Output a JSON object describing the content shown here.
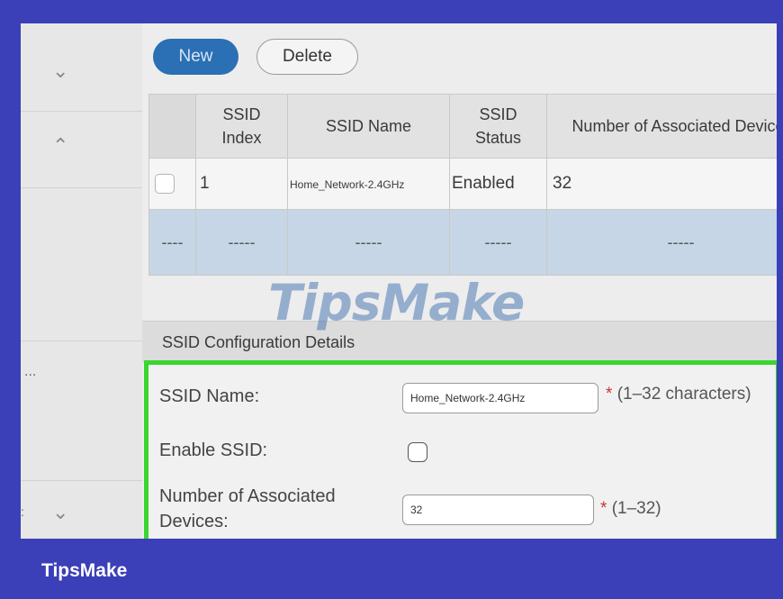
{
  "toolbar": {
    "new_label": "New",
    "delete_label": "Delete"
  },
  "sidebar": {
    "dots": "...",
    "colon": ":"
  },
  "table": {
    "headers": [
      "",
      "SSID Index",
      "SSID Name",
      "SSID Status",
      "Number of Associated Devices"
    ],
    "rows": [
      {
        "index": "1",
        "name": "Home_Network-2.4GHz",
        "status": "Enabled",
        "devices": "32"
      },
      {
        "checkbox": "----",
        "index": "-----",
        "name": "-----",
        "status": "-----",
        "devices": "-----"
      }
    ]
  },
  "watermark": "TipsMake",
  "details": {
    "title": "SSID Configuration Details",
    "ssid_name_label": "SSID Name:",
    "ssid_name_value": "Home_Network-2.4GHz",
    "ssid_name_hint": "(1–32 characters)",
    "enable_label": "Enable SSID:",
    "devices_label_line1": "Number of Associated",
    "devices_label_line2": "Devices:",
    "devices_value": "32",
    "devices_hint": "(1–32)",
    "required_mark": "*"
  },
  "footer": {
    "brand": "TipsMake"
  },
  "colors": {
    "frame_bg": "#3b3fb8",
    "accent": "#2b6fb4",
    "highlight": "#3ad62f",
    "selected_row": "#c6d6e6"
  }
}
